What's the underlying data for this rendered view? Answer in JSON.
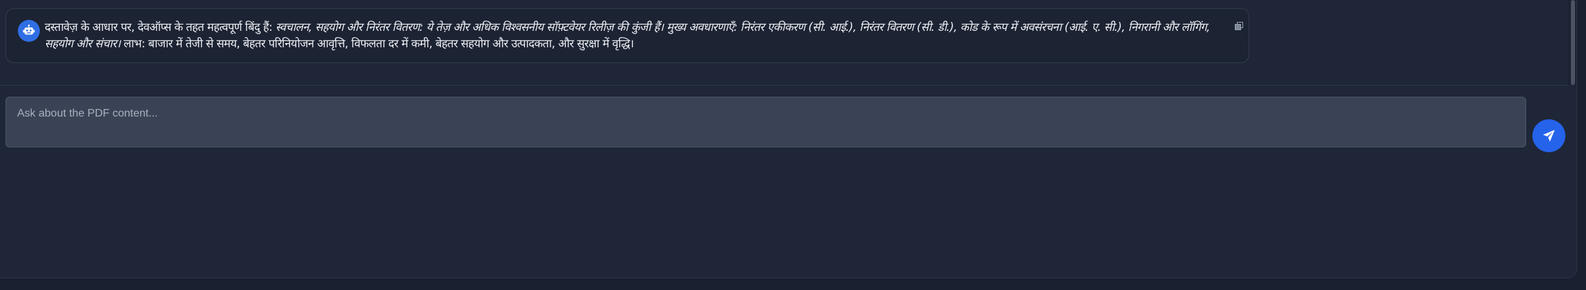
{
  "chat": {
    "assistant_message": {
      "avatar_icon": "robot-icon",
      "part1": "दस्तावेज़ के आधार पर, देवऑप्स के तहत महत्वपूर्ण बिंदु हैं: ",
      "part2": "स्वचालन, सहयोग और निरंतर वितरण: ये तेज़ और अधिक विश्वसनीय सॉफ़्टवेयर रिलीज़ की कुंजी हैं। मुख्य अवधारणाएँ: निरंतर एकीकरण (सी. आई.), निरंतर वितरण (सी. डी.), कोड के रूप में अवसंरचना (आई. ए. सी.), निगरानी और लॉगिंग, सहयोग और संचार।",
      "part3": " लाभ: बाजार में तेजी से समय, बेहतर परिनियोजन आवृत्ति, विफलता दर में कमी, बेहतर सहयोग और उत्पादकता, और सुरक्षा में वृद्धि।",
      "copy_icon": "copy-icon"
    },
    "input": {
      "placeholder": "Ask about the PDF content...",
      "value": ""
    },
    "send_button": {
      "icon": "send-icon"
    }
  },
  "colors": {
    "background": "#1f2637",
    "bubble": "#1c2333",
    "accent": "#2563eb",
    "input": "#3a4356"
  }
}
